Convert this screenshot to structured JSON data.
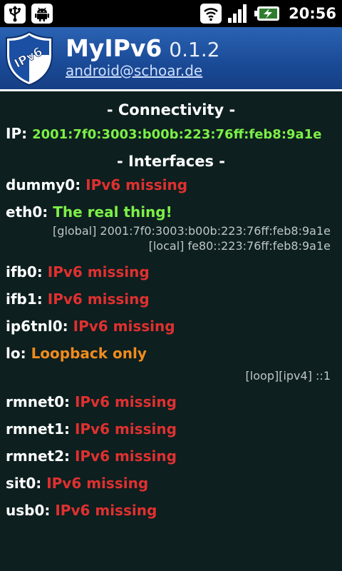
{
  "status_bar": {
    "time": "20:56",
    "icons": [
      "usb-icon",
      "android-icon",
      "wifi-icon",
      "signal-icon",
      "battery-charging-icon"
    ]
  },
  "header": {
    "logo_text": "IPv6",
    "app_name": "MyIPv6",
    "version": "0.1.2",
    "email": "android@schoar.de"
  },
  "connectivity": {
    "title": "- Connectivity -",
    "ip_label": "IP:",
    "ip_value": "2001:7f0:3003:b00b:223:76ff:feb8:9a1e"
  },
  "interfaces_title": "- Interfaces -",
  "interfaces": [
    {
      "name": "dummy0:",
      "status": "IPv6 missing",
      "color": "#e03030"
    },
    {
      "name": "eth0:",
      "status": "The real thing!",
      "color": "#7cf047",
      "details": [
        "[global] 2001:7f0:3003:b00b:223:76ff:feb8:9a1e",
        "[local] fe80::223:76ff:feb8:9a1e"
      ]
    },
    {
      "name": "ifb0:",
      "status": "IPv6 missing",
      "color": "#e03030"
    },
    {
      "name": "ifb1:",
      "status": "IPv6 missing",
      "color": "#e03030"
    },
    {
      "name": "ip6tnl0:",
      "status": "IPv6 missing",
      "color": "#e03030"
    },
    {
      "name": "lo:",
      "status": "Loopback only",
      "color": "#f08c1c",
      "details": [
        "[loop][ipv4] ::1"
      ]
    },
    {
      "name": "rmnet0:",
      "status": "IPv6 missing",
      "color": "#e03030"
    },
    {
      "name": "rmnet1:",
      "status": "IPv6 missing",
      "color": "#e03030"
    },
    {
      "name": "rmnet2:",
      "status": "IPv6 missing",
      "color": "#e03030"
    },
    {
      "name": "sit0:",
      "status": "IPv6 missing",
      "color": "#e03030"
    },
    {
      "name": "usb0:",
      "status": "IPv6 missing",
      "color": "#e03030"
    }
  ]
}
